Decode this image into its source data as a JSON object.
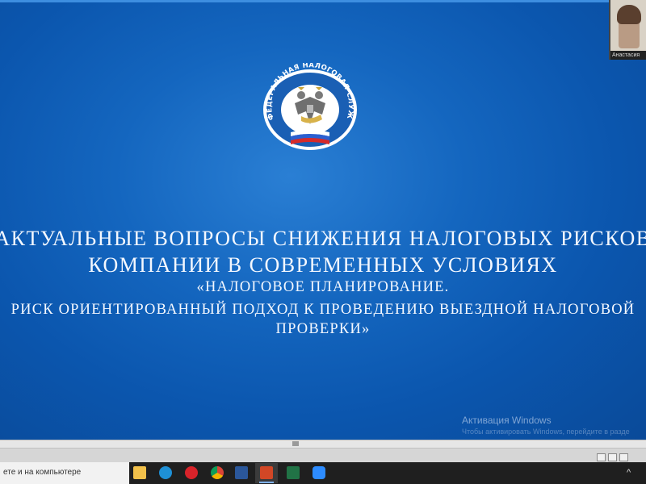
{
  "slide": {
    "emblem": {
      "arc_text": "ФЕДЕРАЛЬНАЯ НАЛОГОВАЯ СЛУЖБА"
    },
    "title_line1": "АКТУАЛЬНЫЕ ВОПРОСЫ СНИЖЕНИЯ НАЛОГОВЫХ РИСКОВ",
    "title_line2": "КОМПАНИИ В СОВРЕМЕННЫХ УСЛОВИЯХ",
    "subtitle_line1": "«НАЛОГОВОЕ ПЛАНИРОВАНИЕ.",
    "subtitle_line2": "РИСК ОРИЕНТИРОВАННЫЙ ПОДХОД К ПРОВЕДЕНИЮ ВЫЕЗДНОЙ НАЛОГОВОЙ",
    "subtitle_line3": "ПРОВЕРКИ»",
    "colors": {
      "background": "#1466bf",
      "text": "#f4f8ff"
    }
  },
  "watermark": {
    "title": "Активация Windows",
    "hint": "Чтобы активировать Windows, перейдите в разде"
  },
  "video_participant": {
    "name": "Анастасия"
  },
  "taskbar": {
    "search_placeholder": "ете и на компьютере",
    "apps": [
      "file-explorer",
      "edge",
      "opera",
      "chrome",
      "word",
      "powerpoint",
      "excel",
      "zoom"
    ],
    "tray_chevron": "^"
  }
}
